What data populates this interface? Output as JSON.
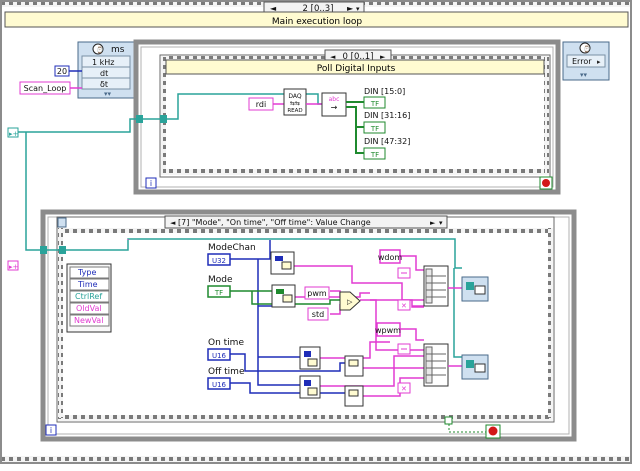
{
  "case_structure": {
    "selector": "2 [0..3]",
    "title": "Main execution loop"
  },
  "timed_loop": {
    "rate_label": "ms",
    "items": [
      "1 kHz",
      "dt",
      "δt"
    ],
    "period_constant": "20",
    "name_constant": "Scan_Loop"
  },
  "poll_frame": {
    "selector": "0 [0..1]",
    "title": "Poll Digital Inputs",
    "rdi_label": "rdi",
    "read_label": "READ",
    "abc_label": "abc",
    "outputs": [
      "DIN [15:0]",
      "DIN [31:16]",
      "DIN [47:32]"
    ],
    "indicator_type": "TF",
    "loop_index": "i"
  },
  "error_node": {
    "label": "Error"
  },
  "event_structure": {
    "selector": "[7] \"Mode\", \"On time\", \"Off time\": Value Change",
    "event_data": [
      "Type",
      "Time",
      "CtrlRef",
      "OldVal",
      "NewVal"
    ],
    "controls": [
      {
        "label": "ModeChan",
        "type": "U32"
      },
      {
        "label": "Mode",
        "type": "TF"
      },
      {
        "label": "On time",
        "type": "U16"
      },
      {
        "label": "Off time",
        "type": "U16"
      }
    ],
    "constants": {
      "pwm": "pwm",
      "std": "std",
      "wdom": "wdom",
      "wpwm": "wpwm"
    },
    "loop_index": "i"
  },
  "colors": {
    "frame_gray": "#8c8c8c",
    "wire_blue": "#1f2db8",
    "wire_pink": "#e23bd2",
    "wire_teal": "#2aa39a",
    "wire_green": "#1f8a2e",
    "case_yellow": "#fffbd1",
    "loop_blue": "#cfe0f0",
    "stop_red": "#d21818"
  }
}
